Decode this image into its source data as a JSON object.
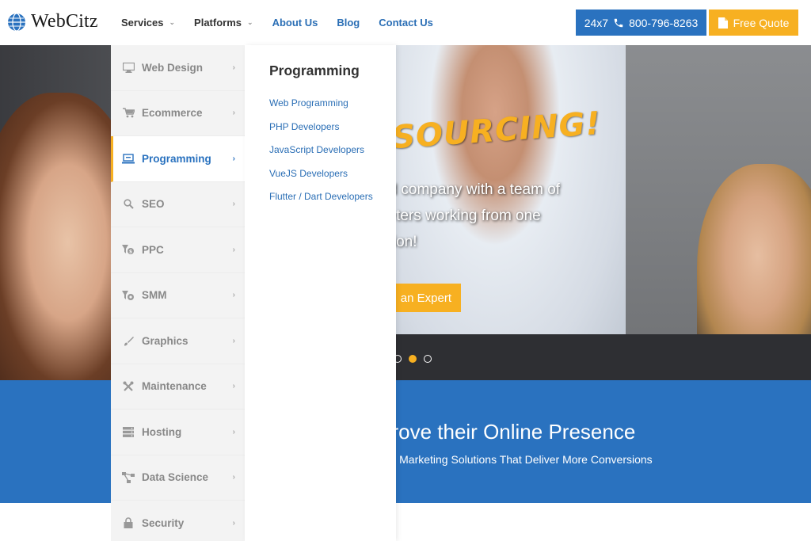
{
  "brand": {
    "name": "WebCitz"
  },
  "nav": {
    "items": [
      {
        "label": "Services",
        "has_dropdown": true
      },
      {
        "label": "Platforms",
        "has_dropdown": true
      },
      {
        "label": "About Us"
      },
      {
        "label": "Blog"
      },
      {
        "label": "Contact Us"
      }
    ],
    "phone": "24x7",
    "phone_number": "800-796-8263",
    "quote": "Free Quote"
  },
  "services_menu": {
    "items": [
      {
        "label": "Web Design",
        "icon": "monitor-icon"
      },
      {
        "label": "Ecommerce",
        "icon": "cart-icon"
      },
      {
        "label": "Programming",
        "icon": "laptop-icon",
        "active": true
      },
      {
        "label": "SEO",
        "icon": "search-icon"
      },
      {
        "label": "PPC",
        "icon": "ppc-icon"
      },
      {
        "label": "SMM",
        "icon": "smm-icon"
      },
      {
        "label": "Graphics",
        "icon": "brush-icon"
      },
      {
        "label": "Maintenance",
        "icon": "tools-icon"
      },
      {
        "label": "Hosting",
        "icon": "server-icon"
      },
      {
        "label": "Data Science",
        "icon": "network-icon"
      },
      {
        "label": "Security",
        "icon": "lock-icon"
      }
    ],
    "submenu": {
      "title": "Programming",
      "links": [
        "Web Programming",
        "PHP Developers",
        "JavaScript Developers",
        "VueJS Developers",
        "Flutter / Dart Developers"
      ]
    }
  },
  "hero": {
    "headline_fragment": "SOURCING!",
    "line1": "ed company with a team of",
    "line2": "keters working from one",
    "line3": "ation!",
    "cta": "an Expert",
    "slides_active_index": 1
  },
  "band": {
    "title": "prove their Online Presence",
    "subtitle": "s & Marketing Solutions That Deliver More Conversions"
  },
  "colors": {
    "primary_blue": "#2a72bf",
    "accent_yellow": "#f7b021"
  }
}
